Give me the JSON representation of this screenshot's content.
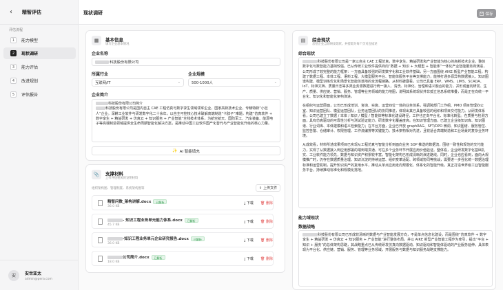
{
  "sidebar": {
    "back_icon": "chevron-left-icon",
    "title": "精智评估",
    "section": "评估流程",
    "items": [
      {
        "num": "1",
        "label": "能力模型"
      },
      {
        "num": "2",
        "label": "现状调研"
      },
      {
        "num": "3",
        "label": "能力评估"
      },
      {
        "num": "4",
        "label": "改进规划"
      },
      {
        "num": "5",
        "label": "评估报告"
      }
    ],
    "user": {
      "avatar": "安",
      "name": "安世亚太",
      "email": "admin@pera.com"
    }
  },
  "header": {
    "title": "现状调研",
    "save_label": "保存",
    "save_icon": "save-icon"
  },
  "basic": {
    "title": "基本信息",
    "subtitle": "填写企业基本情况",
    "company_name_label": "企业名称",
    "company_name": "科技股份有限公司",
    "industry_label": "所属行业",
    "industry": "互联网/IT",
    "scale_label": "企业规模",
    "scale": "500-1000人",
    "intro_label": "企业简介",
    "intro_line1": "科技股份有限公司简介",
    "intro_rest": "科技股份有限公司是国内自主 CAE 工程仿真与数字孪生领域领军企业，国家高新技术企业，专精特新“小巨人”企业。深耕工业软件与研发数字化二十余年，以自主可控核心技术破解高端制造“卡脖子”难题，构建“仿真软件 + 数字孪生 + 精益研发 + 仿真云 + 知识服务 + 产业智能”全栈技术体系，为航空航天、国防军工、汽车装备、能源电子等高端制造领域提供全生命周期智能化解决方案，是推动中国工业软件国产化替代与产业智能化升级的核心力量。",
    "ai_button": "AI 智能填充"
  },
  "materials": {
    "title": "支撑材料",
    "subtitle": "上传评估相关的证明材料",
    "hint": "组织架构图、管理制度、系统架构图等",
    "upload_label": "上传文件",
    "download_label": "下载",
    "delete_label": "删除",
    "files": [
      {
        "name": "精智问数_架构讲解.docx",
        "size": "36.0 KB",
        "status": "已解析"
      },
      {
        "name": "- 知识工程业务单元能力体系.docx",
        "size": "45.7 KB",
        "status": "已解析"
      },
      {
        "name": "-知识工程业务单元企业研究报告.docx",
        "size": "36.0 KB",
        "status": "已解析"
      },
      {
        "name": "公司简介.docx",
        "size": "18.0 KB",
        "status": "已解析"
      }
    ]
  },
  "status": {
    "title": "综合现状",
    "subtitle": "总括企业当前研发现状，并提取为每个页对应描述",
    "section1": "综合现状",
    "p1": "科技股份有限公司是一家以自主 CAE 工程仿真，数字孪生，精益研发和产业智能为核心的高新技术企业，整体数字化与数智能力基础较强。已从传统工业软件提供商向“数据 + 知识 + 大模型 + 智能体”一体化产业智能服务商演进，公司形成了较完整的能力框架：一方面具备较强的研发数字化和工业软件基础，另一方面围绕 AIKE 新型产业智能工程，构建了数据工程、本体工程、语料工程、大模型服务平台、智能体服务平台等支撑能力，能够打通多源异构数据接入、知识图谱构建、模型训练优化和场景化智能体落地的全流程链路。从材料披露看，公司已具备 ERP、WMS、LIMS、SCADA、IoT、标准文档、质量日志等多类业务源数据进行统一接入、清洗、标准化、治理和语义融合的能力，并形成面向研发、生产、质量、供应链、营销、服务、管理等业务领域的能力地图，说明其系统现状并非孤立信息系统堆叠，而是正在向统一平台化、知识化和智能化架构演进。",
    "p2": "在组织与运营层面，公司已形成培训、咨询、实施、运营四位一体的业务体系，强调跨部门工作组、PMO 项目管理办公室、知识运营团队、模型运营团队，业务运营团队的协同推进，体现出其已具备较强的组织和项目交付能力。从研发体系看，公司已建立了数据 / 本体 / 知识 / 模型 / 智能体等标准化建设路径，工作也正向平台化、标准化转型。在质量与检测方面，具有仿真驱动的可靠性分析与测试验证能力，研发数字化覆盖度高。在知识管理方面，已建立企业级知识库、知识图谱、行业词库、本体建模和语义检索能力；在平台方面，企业已开放 graphRAG、SFT/DPO 微调、知识图谱、服务管控、监控告警、仓储审计、权限管理、工作流编排等关键能力。技术架构相对先进，且较适合高端制造和工业场景的复杂业务环境。",
    "p3": "从成效看，材料所述成果项目已实现从工程仿真与智能分析到面向业务 SOP 推送的数据流，围绕一致性和规范的交付能力，实现了从数据接入到应用部署的端到端贯通，可在多个业务环节开展应用价值验证。整体看，企业研发数字化基础扎实、工业软件能力领先，数据与知识资产积累较丰富，智能化架构已形成清晰的演进路线。同时，企业也应看到，面向大规模推广时，仍存在数据质量治理、知识沉淀的持续运营、组织变革适配、跨领域协同等挑战，需要进一步强化统一数据治理标准和运营机制，提升知识资产的复用水平，推动从单点应用走向规模化、体系化的智能升级，真正打造世界级工业智能服务平台，持续推动标准化和规模化落地。",
    "section2": "能力域现状",
    "section3": "数据战略",
    "p4": "科技股份有限公司已形成较清晰的数据与产业智能发展方向，不是单点信息化建设，而是围绕“仿真软件 + 数字孪生 + 精益研发 + 仿真云 + 知识服务 + 产业智能”进行整体布局，并以 AIKE 新型产业智能工程作为牵引，提出“平台 + 知识 + 服务”的总体架构思路，其战略重点已从传统研发仿真向数据驱动、知识驱动和智能体驱动的产业服务延伸，具体表现为平台化、供应链、营销、服务、管理等业务领域，开展服务与数据与知识服务战略支撑能力。"
  }
}
